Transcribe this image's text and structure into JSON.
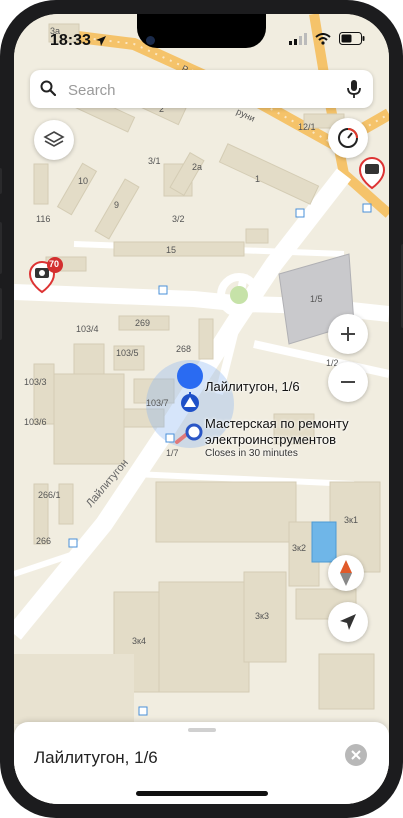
{
  "status_bar": {
    "time": "18:33"
  },
  "search": {
    "placeholder": "Search"
  },
  "map": {
    "selected_place": "Лайлитугон, 1/6",
    "poi": {
      "name_line1": "Мастерская по ремонту",
      "name_line2": "электроинструментов",
      "hours": "Closes in 30 minutes"
    },
    "street_label": "Лайлитугон",
    "camera_badge_count": "70",
    "street_fragment_1": "Р",
    "street_fragment_2": "руни",
    "building_numbers": [
      "3а",
      "2",
      "12/1",
      "3/1",
      "10",
      "2а",
      "1",
      "9",
      "3/2",
      "116",
      "15",
      "1/5",
      "269",
      "103/4",
      "268",
      "103/5",
      "1/2",
      "103/3",
      "103/7",
      "103/6",
      "1/7",
      "266/1",
      "266",
      "3к1",
      "3к2",
      "3к4",
      "3к3"
    ]
  },
  "bottom_sheet": {
    "title": "Лайлитугон, 1/6"
  }
}
